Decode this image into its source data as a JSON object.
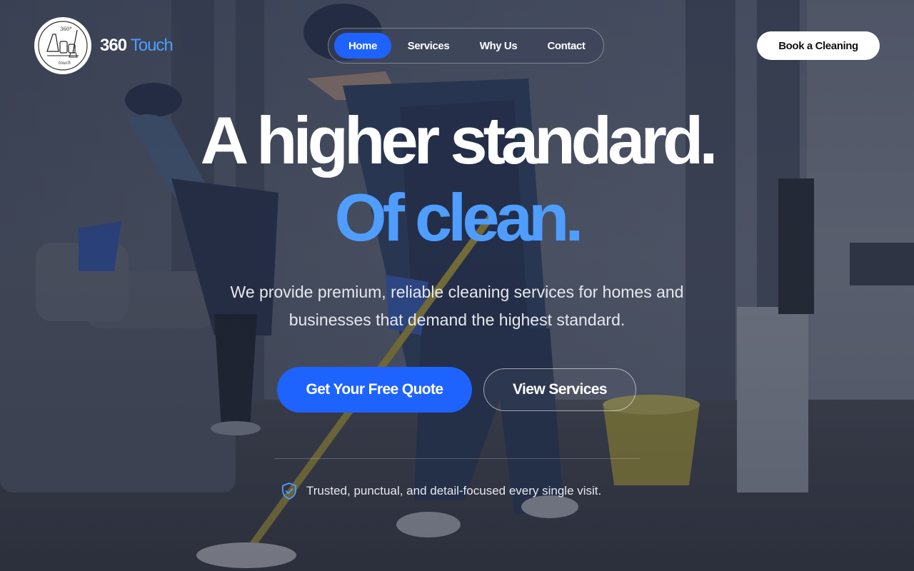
{
  "brand": {
    "name_part1": "360",
    "name_part2": "Touch",
    "logo_text_top": "360°",
    "logo_text_bottom": "touch"
  },
  "nav": {
    "items": [
      {
        "label": "Home",
        "active": true
      },
      {
        "label": "Services",
        "active": false
      },
      {
        "label": "Why Us",
        "active": false
      },
      {
        "label": "Contact",
        "active": false
      }
    ]
  },
  "header": {
    "book_label": "Book a Cleaning"
  },
  "hero": {
    "headline_line1": "A higher standard.",
    "headline_line2": "Of clean.",
    "subtext": "We provide premium, reliable cleaning services for homes and businesses that demand the highest standard.",
    "primary_cta": "Get Your Free Quote",
    "secondary_cta": "View Services",
    "trust_text": "Trusted, punctual, and detail-focused every single visit."
  },
  "icons": {
    "trust": "shield-check-icon",
    "logo": "cleaning-supplies-logo"
  },
  "colors": {
    "accent": "#1f63ff",
    "headline_accent": "#4f9dff",
    "button_light": "#ffffff"
  }
}
